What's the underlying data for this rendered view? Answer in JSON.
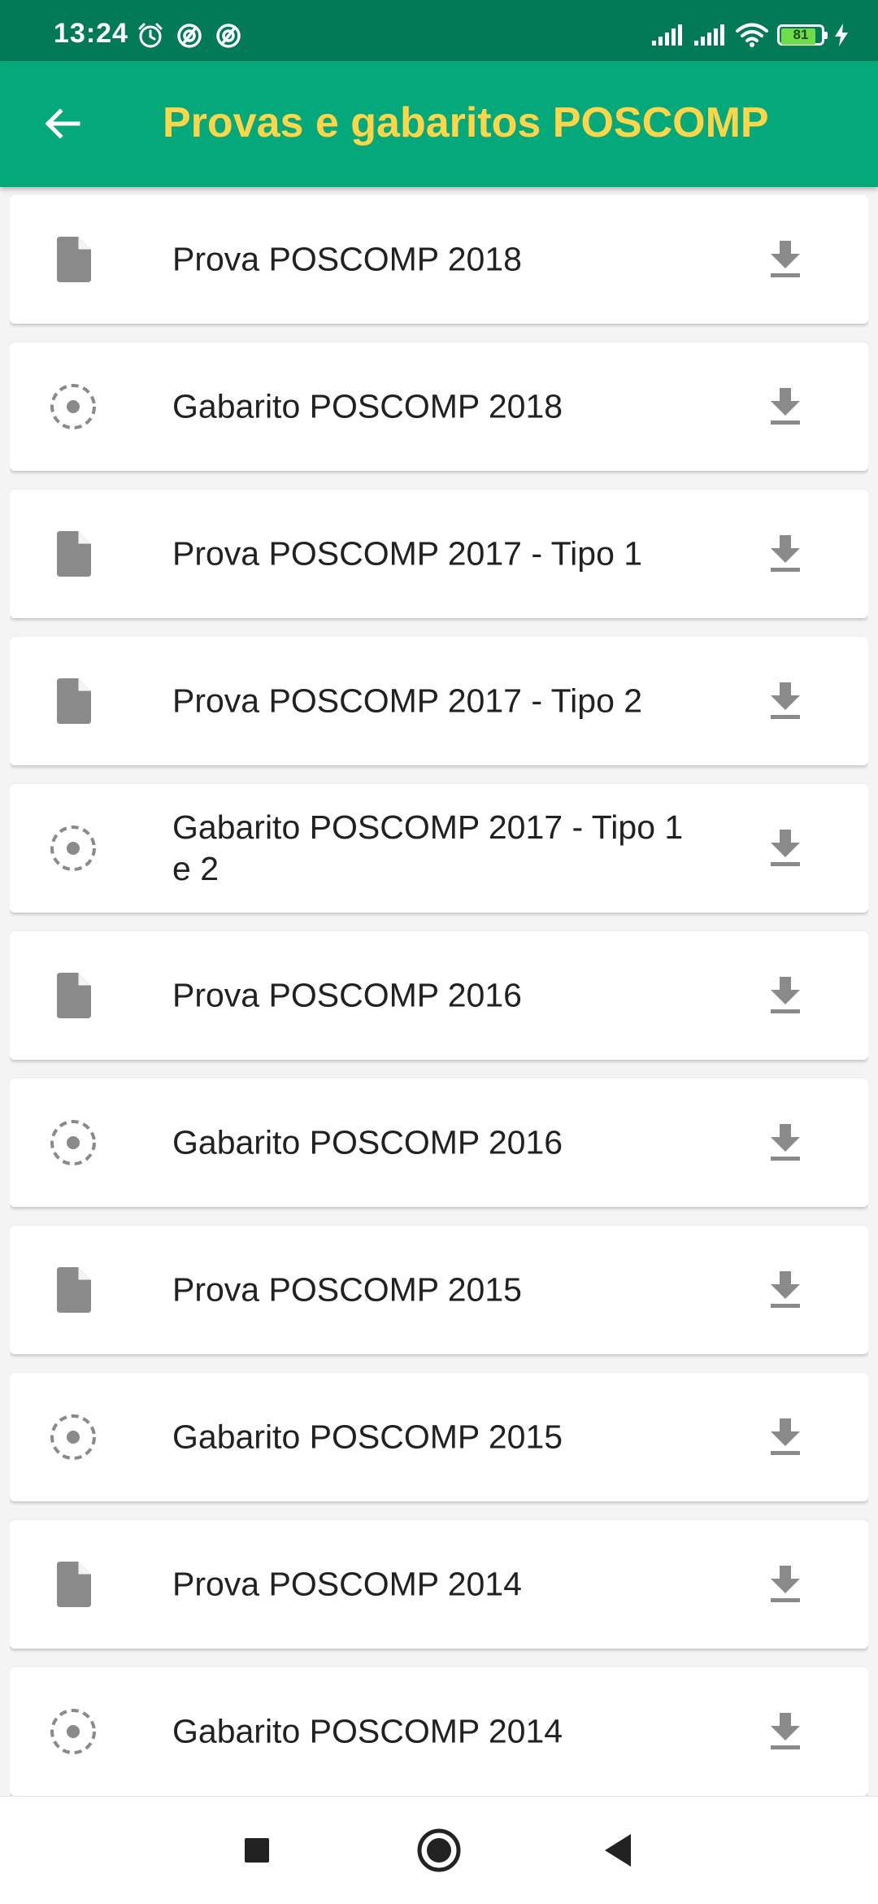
{
  "status_bar": {
    "time": "13:24",
    "battery": "81",
    "left_icons": [
      "alarm-icon",
      "data-saver-icon",
      "data-saver-icon"
    ],
    "right_icons": [
      "signal-icon",
      "signal-icon",
      "wifi-icon",
      "battery-icon",
      "charging-icon"
    ]
  },
  "app_bar": {
    "title": "Provas e gabaritos POSCOMP",
    "back_icon": "arrow-back-icon"
  },
  "colors": {
    "status_bar": "#037a57",
    "app_bar": "#04a87a",
    "title": "#ffd54a",
    "icon_gray": "#8a8a8a"
  },
  "items": [
    {
      "label": "Prova POSCOMP 2018",
      "icon": "document-icon"
    },
    {
      "label": "Gabarito POSCOMP 2018",
      "icon": "answer-key-icon"
    },
    {
      "label": "Prova POSCOMP 2017 - Tipo 1",
      "icon": "document-icon"
    },
    {
      "label": "Prova POSCOMP 2017 - Tipo 2",
      "icon": "document-icon"
    },
    {
      "label": "Gabarito POSCOMP 2017 - Tipo 1 e 2",
      "icon": "answer-key-icon"
    },
    {
      "label": "Prova POSCOMP 2016",
      "icon": "document-icon"
    },
    {
      "label": "Gabarito POSCOMP 2016",
      "icon": "answer-key-icon"
    },
    {
      "label": "Prova POSCOMP 2015",
      "icon": "document-icon"
    },
    {
      "label": "Gabarito POSCOMP 2015",
      "icon": "answer-key-icon"
    },
    {
      "label": "Prova POSCOMP 2014",
      "icon": "document-icon"
    },
    {
      "label": "Gabarito POSCOMP 2014",
      "icon": "answer-key-icon"
    }
  ],
  "nav_bar": {
    "buttons": [
      "recents-icon",
      "home-icon",
      "back-icon"
    ]
  }
}
